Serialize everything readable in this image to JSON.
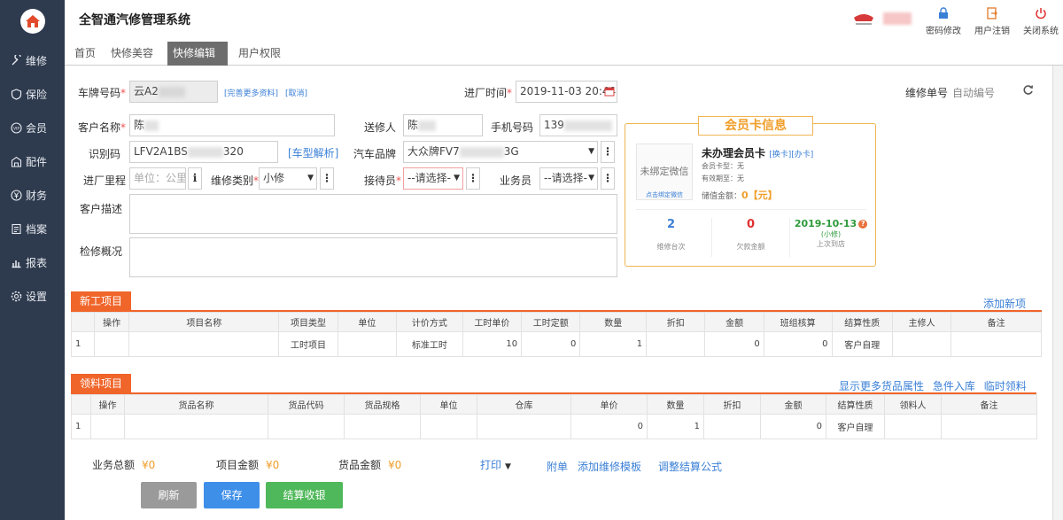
{
  "app": {
    "title": "全智通汽修管理系统"
  },
  "sidebar": {
    "items": [
      {
        "label": "维修",
        "icon": "wrench-icon"
      },
      {
        "label": "保险",
        "icon": "shield-icon"
      },
      {
        "label": "会员",
        "icon": "vip-icon"
      },
      {
        "label": "配件",
        "icon": "parts-icon"
      },
      {
        "label": "财务",
        "icon": "yen-icon"
      },
      {
        "label": "档案",
        "icon": "archive-icon"
      },
      {
        "label": "报表",
        "icon": "chart-icon"
      },
      {
        "label": "设置",
        "icon": "gear-icon"
      }
    ]
  },
  "topbar": {
    "change_password": "密码修改",
    "logout": "用户注销",
    "close_system": "关闭系统"
  },
  "tabs": [
    {
      "label": "首页"
    },
    {
      "label": "快修美容"
    },
    {
      "label": "快修编辑",
      "close": "×"
    },
    {
      "label": "用户权限"
    }
  ],
  "form": {
    "plate_label": "车牌号码",
    "plate_value": "云A2",
    "more_info_link": "[完善更多资料]",
    "cancel_link": "[取消]",
    "entry_time_label": "进厂时间",
    "entry_time_value": "2019-11-03 20:44:",
    "repair_no_label": "维修单号",
    "repair_no_value": "自动编号",
    "customer_label": "客户名称",
    "customer_value": "陈",
    "sender_label": "送修人",
    "sender_value": "陈",
    "phone_label": "手机号码",
    "phone_value": "139",
    "vin_label": "识别码",
    "vin_value_a": "LFV2A1BS",
    "vin_value_b": "320",
    "vin_parse_link": "[车型解析]",
    "brand_label": "汽车品牌",
    "brand_value_a": "大众牌FV7",
    "brand_value_b": "3G",
    "mileage_label": "进厂里程",
    "mileage_placeholder": "单位：公里",
    "mileage_info": "i",
    "repair_type_label": "维修类别",
    "repair_type_value": "小修",
    "receptionist_label": "接待员",
    "receptionist_value": "--请选择-",
    "salesman_label": "业务员",
    "salesman_value": "--请选择-",
    "customer_desc_label": "客户描述",
    "inspection_label": "检修概况",
    "required_mark": "*",
    "dots": "⋮",
    "arrow": "▼"
  },
  "member": {
    "title": "会员卡信息",
    "wechat_text": "未绑定微信",
    "wechat_bind": "点击绑定微信",
    "card_status": "未办理会员卡",
    "change_card": "[换卡]",
    "apply_card": "[办卡]",
    "card_type": "会员卡型：无",
    "valid_until": "有效期至：无",
    "balance_label": "储值金额：",
    "balance_value": "0【元】",
    "stats": [
      {
        "value": "2",
        "label": "维修台次",
        "color": "#3a7fd6"
      },
      {
        "value": "0",
        "label": "欠款金额",
        "color": "#e03030"
      },
      {
        "value": "2019-10-13",
        "sub": "(小修)",
        "label": "上次到店",
        "color": "#2e9a3a"
      }
    ]
  },
  "labor": {
    "tag": "新工项目",
    "add_link": "添加新项",
    "columns": [
      "",
      "操作",
      "项目名称",
      "项目类型",
      "单位",
      "计价方式",
      "工时单价",
      "工时定额",
      "数量",
      "折扣",
      "金额",
      "班组核算",
      "结算性质",
      "主修人",
      "备注"
    ],
    "rows": [
      [
        "1",
        "",
        "",
        "工时项目",
        "",
        "标准工时",
        "10",
        "0",
        "1",
        "",
        "0",
        "0",
        "客户自理",
        "",
        ""
      ]
    ]
  },
  "parts": {
    "tag": "领料项目",
    "links": [
      "显示更多货品属性",
      "急件入库",
      "临时领料"
    ],
    "columns": [
      "",
      "操作",
      "货品名称",
      "货品代码",
      "货品规格",
      "单位",
      "仓库",
      "单价",
      "数量",
      "折扣",
      "金额",
      "结算性质",
      "领料人",
      "备注"
    ],
    "rows": [
      [
        "1",
        "",
        "",
        "",
        "",
        "",
        "",
        "0",
        "1",
        "",
        "0",
        "客户自理",
        "",
        ""
      ]
    ]
  },
  "summary": {
    "total_label": "业务总额",
    "total_value": "¥0",
    "labor_label": "项目金额",
    "labor_value": "¥0",
    "parts_label": "货品金额",
    "parts_value": "¥0",
    "print": "打印",
    "attachment": "附单",
    "add_template": "添加维修模板",
    "adjust_formula": "调整结算公式"
  },
  "buttons": {
    "refresh": "刷新",
    "save": "保存",
    "settle": "结算收银"
  }
}
